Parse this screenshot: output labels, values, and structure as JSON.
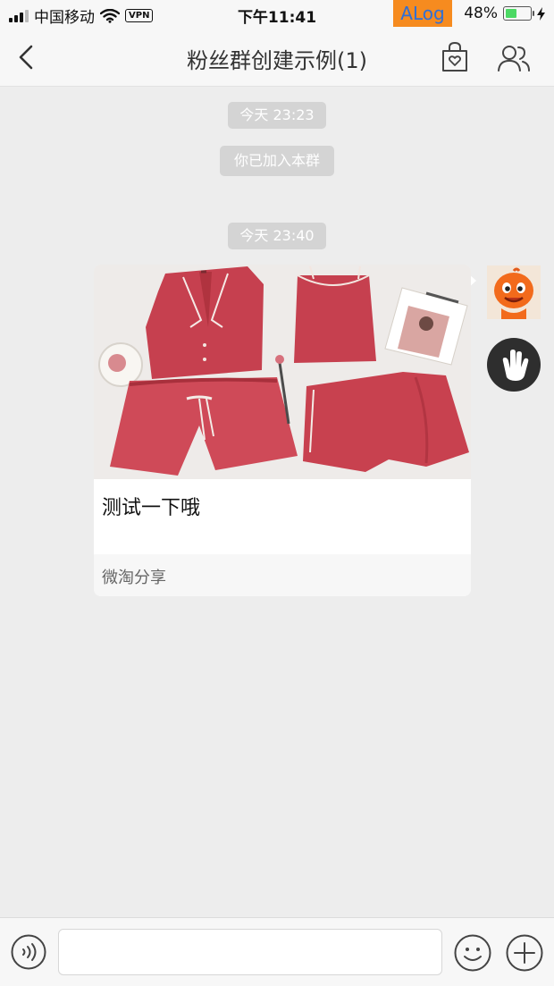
{
  "status_bar": {
    "carrier": "中国移动",
    "vpn": "VPN",
    "time": "下午11:41",
    "alog": "ALog",
    "battery": "48%",
    "battery_level": 0.48
  },
  "nav": {
    "title": "粉丝群创建示例(1)"
  },
  "chat": {
    "timestamp_1": "今天 23:23",
    "system_message": "你已加入本群",
    "timestamp_2": "今天 23:40",
    "card": {
      "title": "测试一下哦",
      "source": "微淘分享"
    }
  },
  "input": {
    "value": "",
    "placeholder": ""
  },
  "colors": {
    "background": "#ededed",
    "bar": "#f7f7f7",
    "timestamp_bg": "#d4d4d4",
    "alog_orange": "#f68b1f",
    "product_red": "#c6404f",
    "battery_green": "#4cd964"
  }
}
